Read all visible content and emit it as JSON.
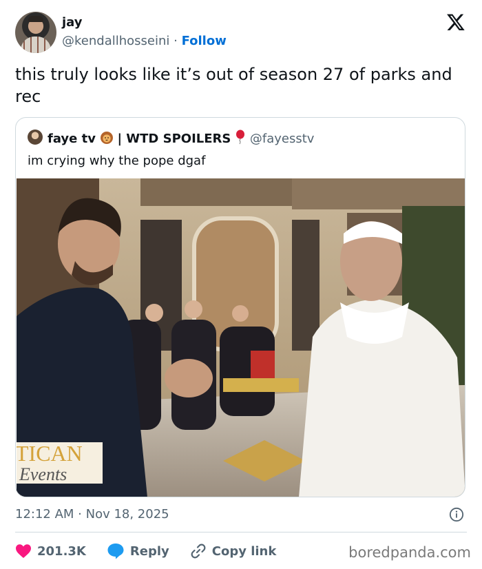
{
  "author": {
    "display_name": "jay",
    "handle": "@kendallhosseini",
    "separator": " · ",
    "follow_label": "Follow"
  },
  "tweet": {
    "text": "this truly looks like it’s out of season 27 of parks and rec",
    "timestamp": "12:12 AM · Nov 18, 2025"
  },
  "quote": {
    "display_name": "faye tv",
    "name_suffix": "| WTD SPOILERS",
    "handle": "@fayesstv",
    "text": "im crying why the pope dgaf",
    "photo_caption_line1": "TICAN",
    "photo_caption_line2": "Events"
  },
  "actions": {
    "likes": "201.3K",
    "reply_label": "Reply",
    "copy_label": "Copy link"
  },
  "watermark": "boredpanda.com",
  "icons": {
    "x_logo": "x-logo-icon",
    "info": "info-icon",
    "heart": "heart-icon",
    "reply": "reply-icon",
    "link": "link-icon"
  },
  "colors": {
    "follow": "#006fd6",
    "heart": "#f91880",
    "reply": "#1d9bf0",
    "muted": "#536471"
  }
}
